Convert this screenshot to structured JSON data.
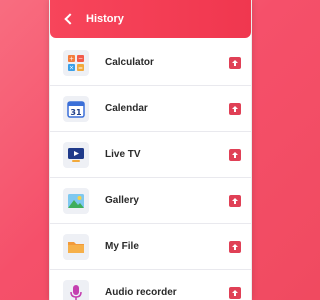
{
  "header": {
    "title": "History"
  },
  "items": [
    {
      "label": "Calculator",
      "icon": "calculator-icon"
    },
    {
      "label": "Calendar",
      "icon": "calendar-icon",
      "icon_text": "31"
    },
    {
      "label": "Live TV",
      "icon": "tv-icon"
    },
    {
      "label": "Gallery",
      "icon": "gallery-icon"
    },
    {
      "label": "My File",
      "icon": "folder-icon"
    },
    {
      "label": "Audio recorder",
      "icon": "microphone-icon"
    }
  ],
  "colors": {
    "accent": "#f0374f",
    "background": "#f5506a",
    "action": "#e04056"
  }
}
